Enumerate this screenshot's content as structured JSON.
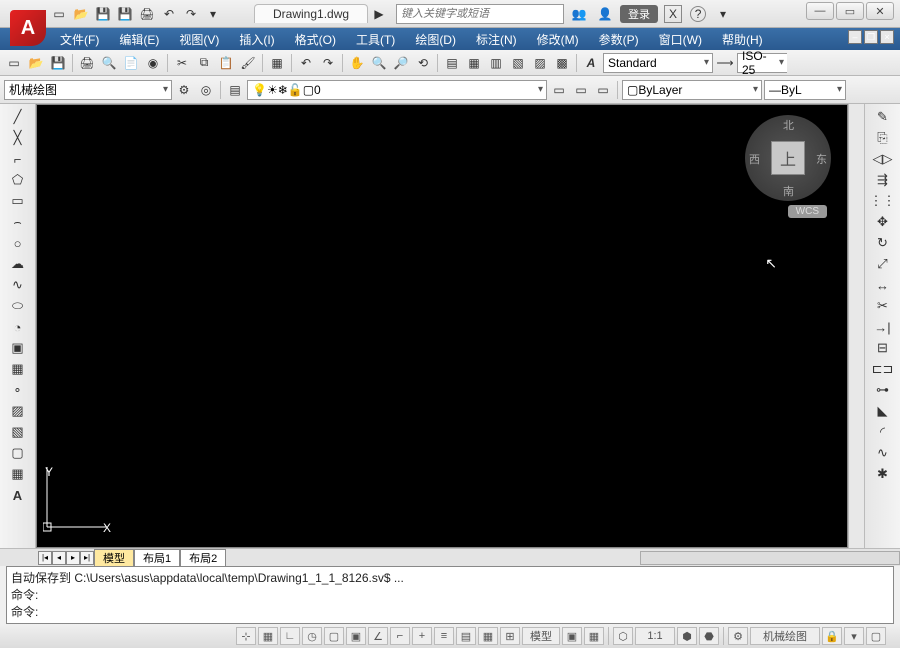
{
  "app_letter": "A",
  "title_tab": "Drawing1.dwg",
  "search_placeholder": "键入关键字或短语",
  "login_label": "登录",
  "menu": [
    "文件(F)",
    "编辑(E)",
    "视图(V)",
    "插入(I)",
    "格式(O)",
    "工具(T)",
    "绘图(D)",
    "标注(N)",
    "修改(M)",
    "参数(P)",
    "窗口(W)",
    "帮助(H)"
  ],
  "style_combo": "Standard",
  "iso_combo": "ISO-25",
  "workspace_combo": "机械绘图",
  "layer_combo": "0",
  "bylayer_combo": "ByLayer",
  "linetype_combo": "ByL",
  "navcube": {
    "n": "北",
    "s": "南",
    "e": "东",
    "w": "西",
    "face": "上"
  },
  "wcs": "WCS",
  "ucs": {
    "x": "X",
    "y": "Y"
  },
  "model_tabs": {
    "model": "模型",
    "l1": "布局1",
    "l2": "布局2"
  },
  "cmd_lines": {
    "l1": "自动保存到 C:\\Users\\asus\\appdata\\local\\temp\\Drawing1_1_1_8126.sv$ ...",
    "l2": "命令:",
    "l3": "",
    "l4": "命令:"
  },
  "status": {
    "coords": "",
    "model": "模型",
    "scale": "1:1",
    "ws": "机械绘图"
  },
  "left_tools": [
    "line",
    "cline",
    "pline",
    "poly",
    "rect",
    "arc",
    "circle",
    "spline1",
    "spline2",
    "ellipse",
    "earc",
    "donut",
    "block",
    "hatch",
    "grad",
    "region",
    "table",
    "mtext",
    "A"
  ],
  "right_tools": [
    "dist",
    "dim",
    "mirror",
    "offset",
    "array",
    "move",
    "rotate",
    "scale",
    "stretch",
    "trim",
    "extend",
    "break",
    "break2",
    "join",
    "chamfer",
    "fillet",
    "blend",
    "explode"
  ]
}
